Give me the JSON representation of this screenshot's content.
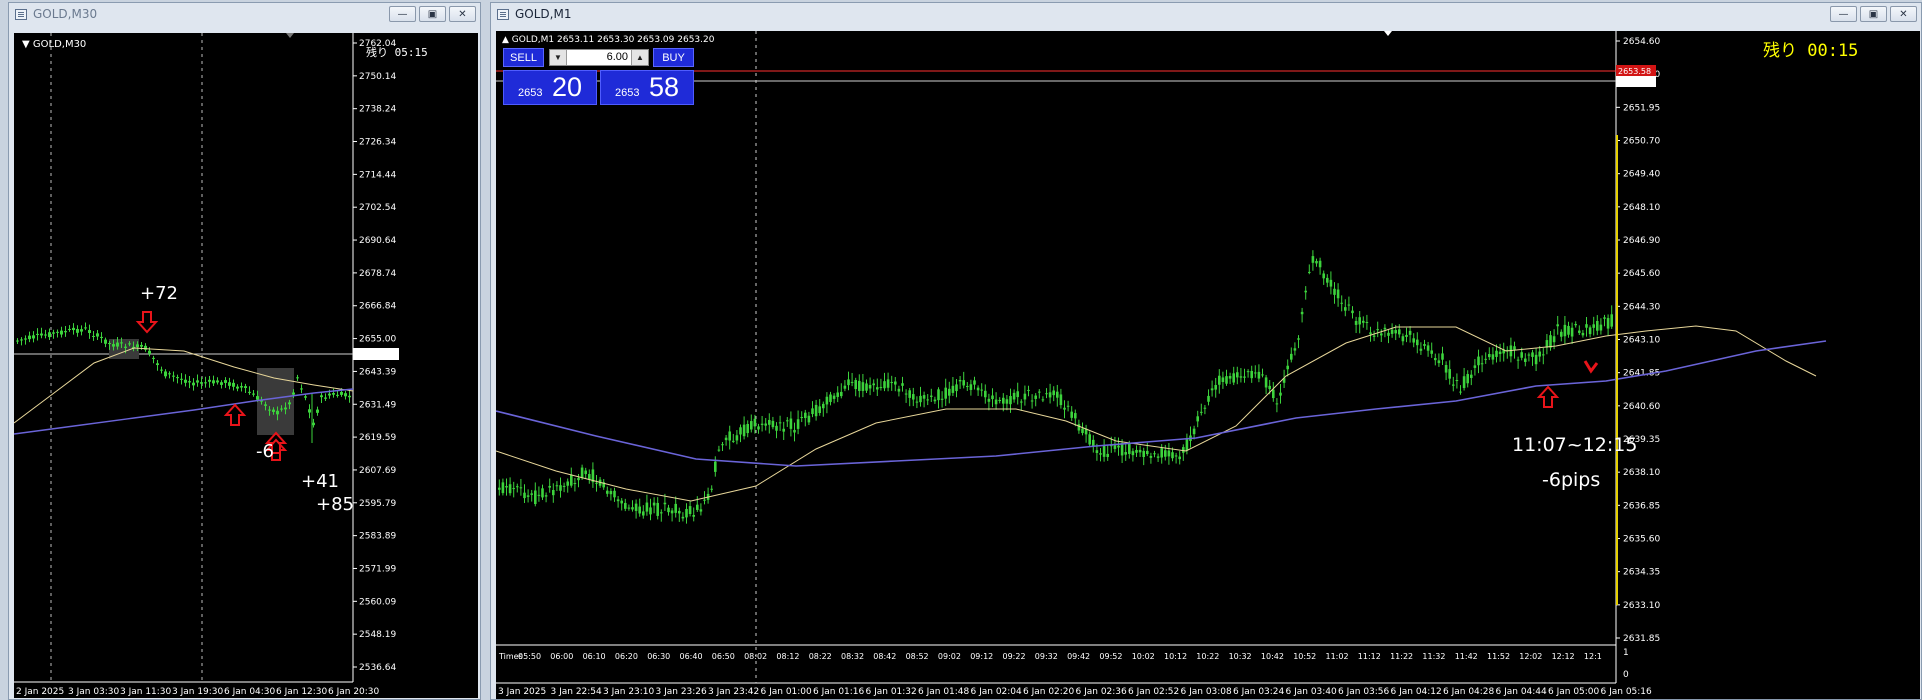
{
  "left_window": {
    "title": "GOLD,M30",
    "chart_label": "GOLD,M30",
    "timer": "残り 05:15",
    "current_price": "2653.20",
    "y_ticks": [
      "2762.04",
      "2750.14",
      "2738.24",
      "2726.34",
      "2714.44",
      "2702.54",
      "2690.64",
      "2678.74",
      "2666.84",
      "2655.00",
      "2643.39",
      "2631.49",
      "2619.59",
      "2607.69",
      "2595.79",
      "2583.89",
      "2571.99",
      "2560.09",
      "2548.19",
      "2536.64"
    ],
    "x_ticks": [
      "2 Jan 2025",
      "3 Jan 03:30",
      "3 Jan 11:30",
      "3 Jan 19:30",
      "6 Jan 04:30",
      "6 Jan 12:30",
      "6 Jan 20:30"
    ],
    "annotations": {
      "a1": "+72",
      "a2": "-6",
      "a3": "+41",
      "a4": "+85"
    }
  },
  "right_window": {
    "title": "GOLD,M1",
    "chart_label": "GOLD,M1  2653.11 2653.30 2653.09 2653.20",
    "timer": "残り 00:15",
    "current_price": "2653.20",
    "ask_price": "2653.58",
    "trade_panel": {
      "sell_label": "SELL",
      "buy_label": "BUY",
      "lots": "6.00",
      "bid_small": "2653",
      "bid_big": "20",
      "ask_small": "2653",
      "ask_big": "58"
    },
    "y_ticks": [
      "2654.60",
      "2653.20",
      "2651.95",
      "2650.70",
      "2649.40",
      "2648.10",
      "2646.90",
      "2645.60",
      "2644.30",
      "2643.10",
      "2641.85",
      "2640.60",
      "2639.35",
      "2638.10",
      "2636.85",
      "2635.60",
      "2634.35",
      "2633.10",
      "2631.85"
    ],
    "sub_ticks": [
      "0",
      "1"
    ],
    "sub_label": "Times",
    "x_top_ticks": [
      "05:50",
      "06:00",
      "06:10",
      "06:20",
      "06:30",
      "06:40",
      "06:50",
      "08:02",
      "08:12",
      "08:22",
      "08:32",
      "08:42",
      "08:52",
      "09:02",
      "09:12",
      "09:22",
      "09:32",
      "09:42",
      "09:52",
      "10:02",
      "10:12",
      "10:22",
      "10:32",
      "10:42",
      "10:52",
      "11:02",
      "11:12",
      "11:22",
      "11:32",
      "11:42",
      "11:52",
      "12:02",
      "12:12",
      "12:1"
    ],
    "x_ticks": [
      "3 Jan 2025",
      "3 Jan 22:54",
      "3 Jan 23:10",
      "3 Jan 23:26",
      "3 Jan 23:42",
      "6 Jan 01:00",
      "6 Jan 01:16",
      "6 Jan 01:32",
      "6 Jan 01:48",
      "6 Jan 02:04",
      "6 Jan 02:20",
      "6 Jan 02:36",
      "6 Jan 02:52",
      "6 Jan 03:08",
      "6 Jan 03:24",
      "6 Jan 03:40",
      "6 Jan 03:56",
      "6 Jan 04:12",
      "6 Jan 04:28",
      "6 Jan 04:44",
      "6 Jan 05:00",
      "6 Jan 05:16"
    ],
    "annotations": {
      "time_range": "11:07~12:15",
      "pips": "-6pips"
    }
  },
  "colors": {
    "candle": "#3cd33c",
    "ma_fast": "#e8d79a",
    "ma_slow": "#6a64d8",
    "arrow": "#e8141a",
    "panel": "#1f2bd8"
  }
}
